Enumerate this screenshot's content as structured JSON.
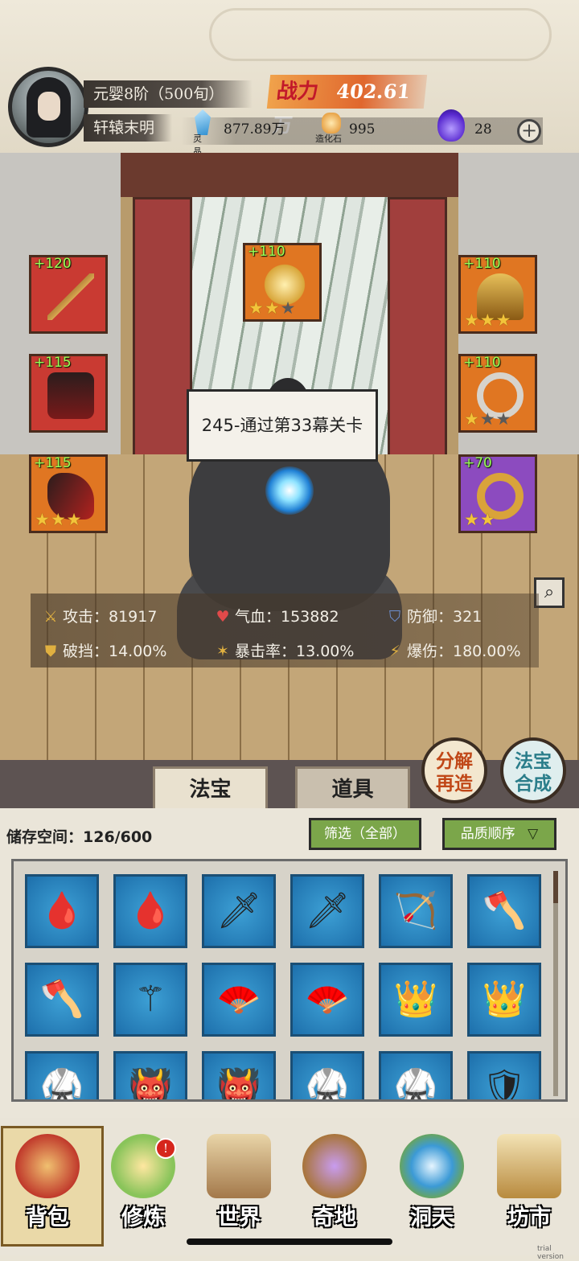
{
  "player": {
    "realm": "元婴8阶（500旬）",
    "name": "轩辕末明",
    "power_label": "战力",
    "power_value": "402.61万"
  },
  "currencies": [
    {
      "name": "灵晶",
      "value": "877.89万",
      "icon": "crystal-icon",
      "color": "#3fa0d8"
    },
    {
      "name": "造化石",
      "value": "995",
      "icon": "stone-icon",
      "color": "#e8a23a"
    },
    {
      "name": "",
      "value": "28",
      "icon": "purple-flame-icon",
      "color": "#6a3fd8"
    }
  ],
  "quest": {
    "text": "245-通过第33幕关卡"
  },
  "equipment": [
    {
      "slot": "left-1",
      "plus": "+120",
      "stars": 0,
      "max_stars": 0,
      "icon": "staff-icon",
      "bg": "#c93a32"
    },
    {
      "slot": "left-2",
      "plus": "+115",
      "stars": 0,
      "max_stars": 0,
      "icon": "robe-icon",
      "bg": "#c93a32"
    },
    {
      "slot": "left-3",
      "plus": "+115",
      "stars": 3,
      "max_stars": 3,
      "icon": "boots-icon",
      "bg": "#e07622"
    },
    {
      "slot": "center",
      "plus": "+110",
      "stars": 2,
      "max_stars": 3,
      "icon": "cloud-charm-icon",
      "bg": "#e07622"
    },
    {
      "slot": "right-1",
      "plus": "+110",
      "stars": 3,
      "max_stars": 3,
      "icon": "crown-icon",
      "bg": "#e07622"
    },
    {
      "slot": "right-2",
      "plus": "+110",
      "stars": 1,
      "max_stars": 3,
      "icon": "pendant-icon",
      "bg": "#e07622"
    },
    {
      "slot": "right-3",
      "plus": "+70",
      "stars": 2,
      "max_stars": 2,
      "icon": "ring-icon",
      "bg": "#8c4bbf"
    }
  ],
  "stats": {
    "attack": "攻击：81917",
    "hp": "气血：153882",
    "defense": "防御：321",
    "break": "破挡：14.00%",
    "crit_rate": "暴击率：13.00%",
    "crit_dmg": "爆伤：180.00%"
  },
  "tabs": {
    "fabao": "法宝",
    "daoju": "道具"
  },
  "round_buttons": {
    "decompose": [
      "分解",
      "再造"
    ],
    "synthesize": [
      "法宝",
      "合成"
    ]
  },
  "inventory": {
    "storage": "储存空间：126/600",
    "filter": "筛选（全部）",
    "sort": "品质顺序",
    "items": [
      {
        "icon": "red-boots-icon",
        "glyph": "🩸"
      },
      {
        "icon": "red-boots-icon",
        "glyph": "🩸"
      },
      {
        "icon": "ice-sword-icon",
        "glyph": "🗡"
      },
      {
        "icon": "ice-sword-icon",
        "glyph": "🗡"
      },
      {
        "icon": "ice-bow-icon",
        "glyph": "🏹"
      },
      {
        "icon": "axe-icon",
        "glyph": "🪓"
      },
      {
        "icon": "axe-icon",
        "glyph": "🪓"
      },
      {
        "icon": "staff-icon",
        "glyph": "⚚"
      },
      {
        "icon": "jade-fan-icon",
        "glyph": "🪭"
      },
      {
        "icon": "jade-fan-icon",
        "glyph": "🪭"
      },
      {
        "icon": "golden-helm-icon",
        "glyph": "👑"
      },
      {
        "icon": "golden-helm-icon",
        "glyph": "👑"
      },
      {
        "icon": "robe-icon",
        "glyph": "🥋"
      },
      {
        "icon": "demon-mask-icon",
        "glyph": "👹"
      },
      {
        "icon": "demon-mask-icon",
        "glyph": "👹"
      },
      {
        "icon": "dark-robe-icon",
        "glyph": "🥋"
      },
      {
        "icon": "dark-robe-icon",
        "glyph": "🥋"
      },
      {
        "icon": "armor-icon",
        "glyph": "🛡"
      }
    ]
  },
  "nav": [
    {
      "label": "背包",
      "icon": "bag-icon",
      "active": true
    },
    {
      "label": "修炼",
      "icon": "lotus-icon",
      "badge": "!"
    },
    {
      "label": "世界",
      "icon": "scroll-map-icon"
    },
    {
      "label": "奇地",
      "icon": "pagoda-icon"
    },
    {
      "label": "洞天",
      "icon": "portal-icon"
    },
    {
      "label": "坊市",
      "icon": "market-icon"
    }
  ],
  "trial_text": "trial version"
}
